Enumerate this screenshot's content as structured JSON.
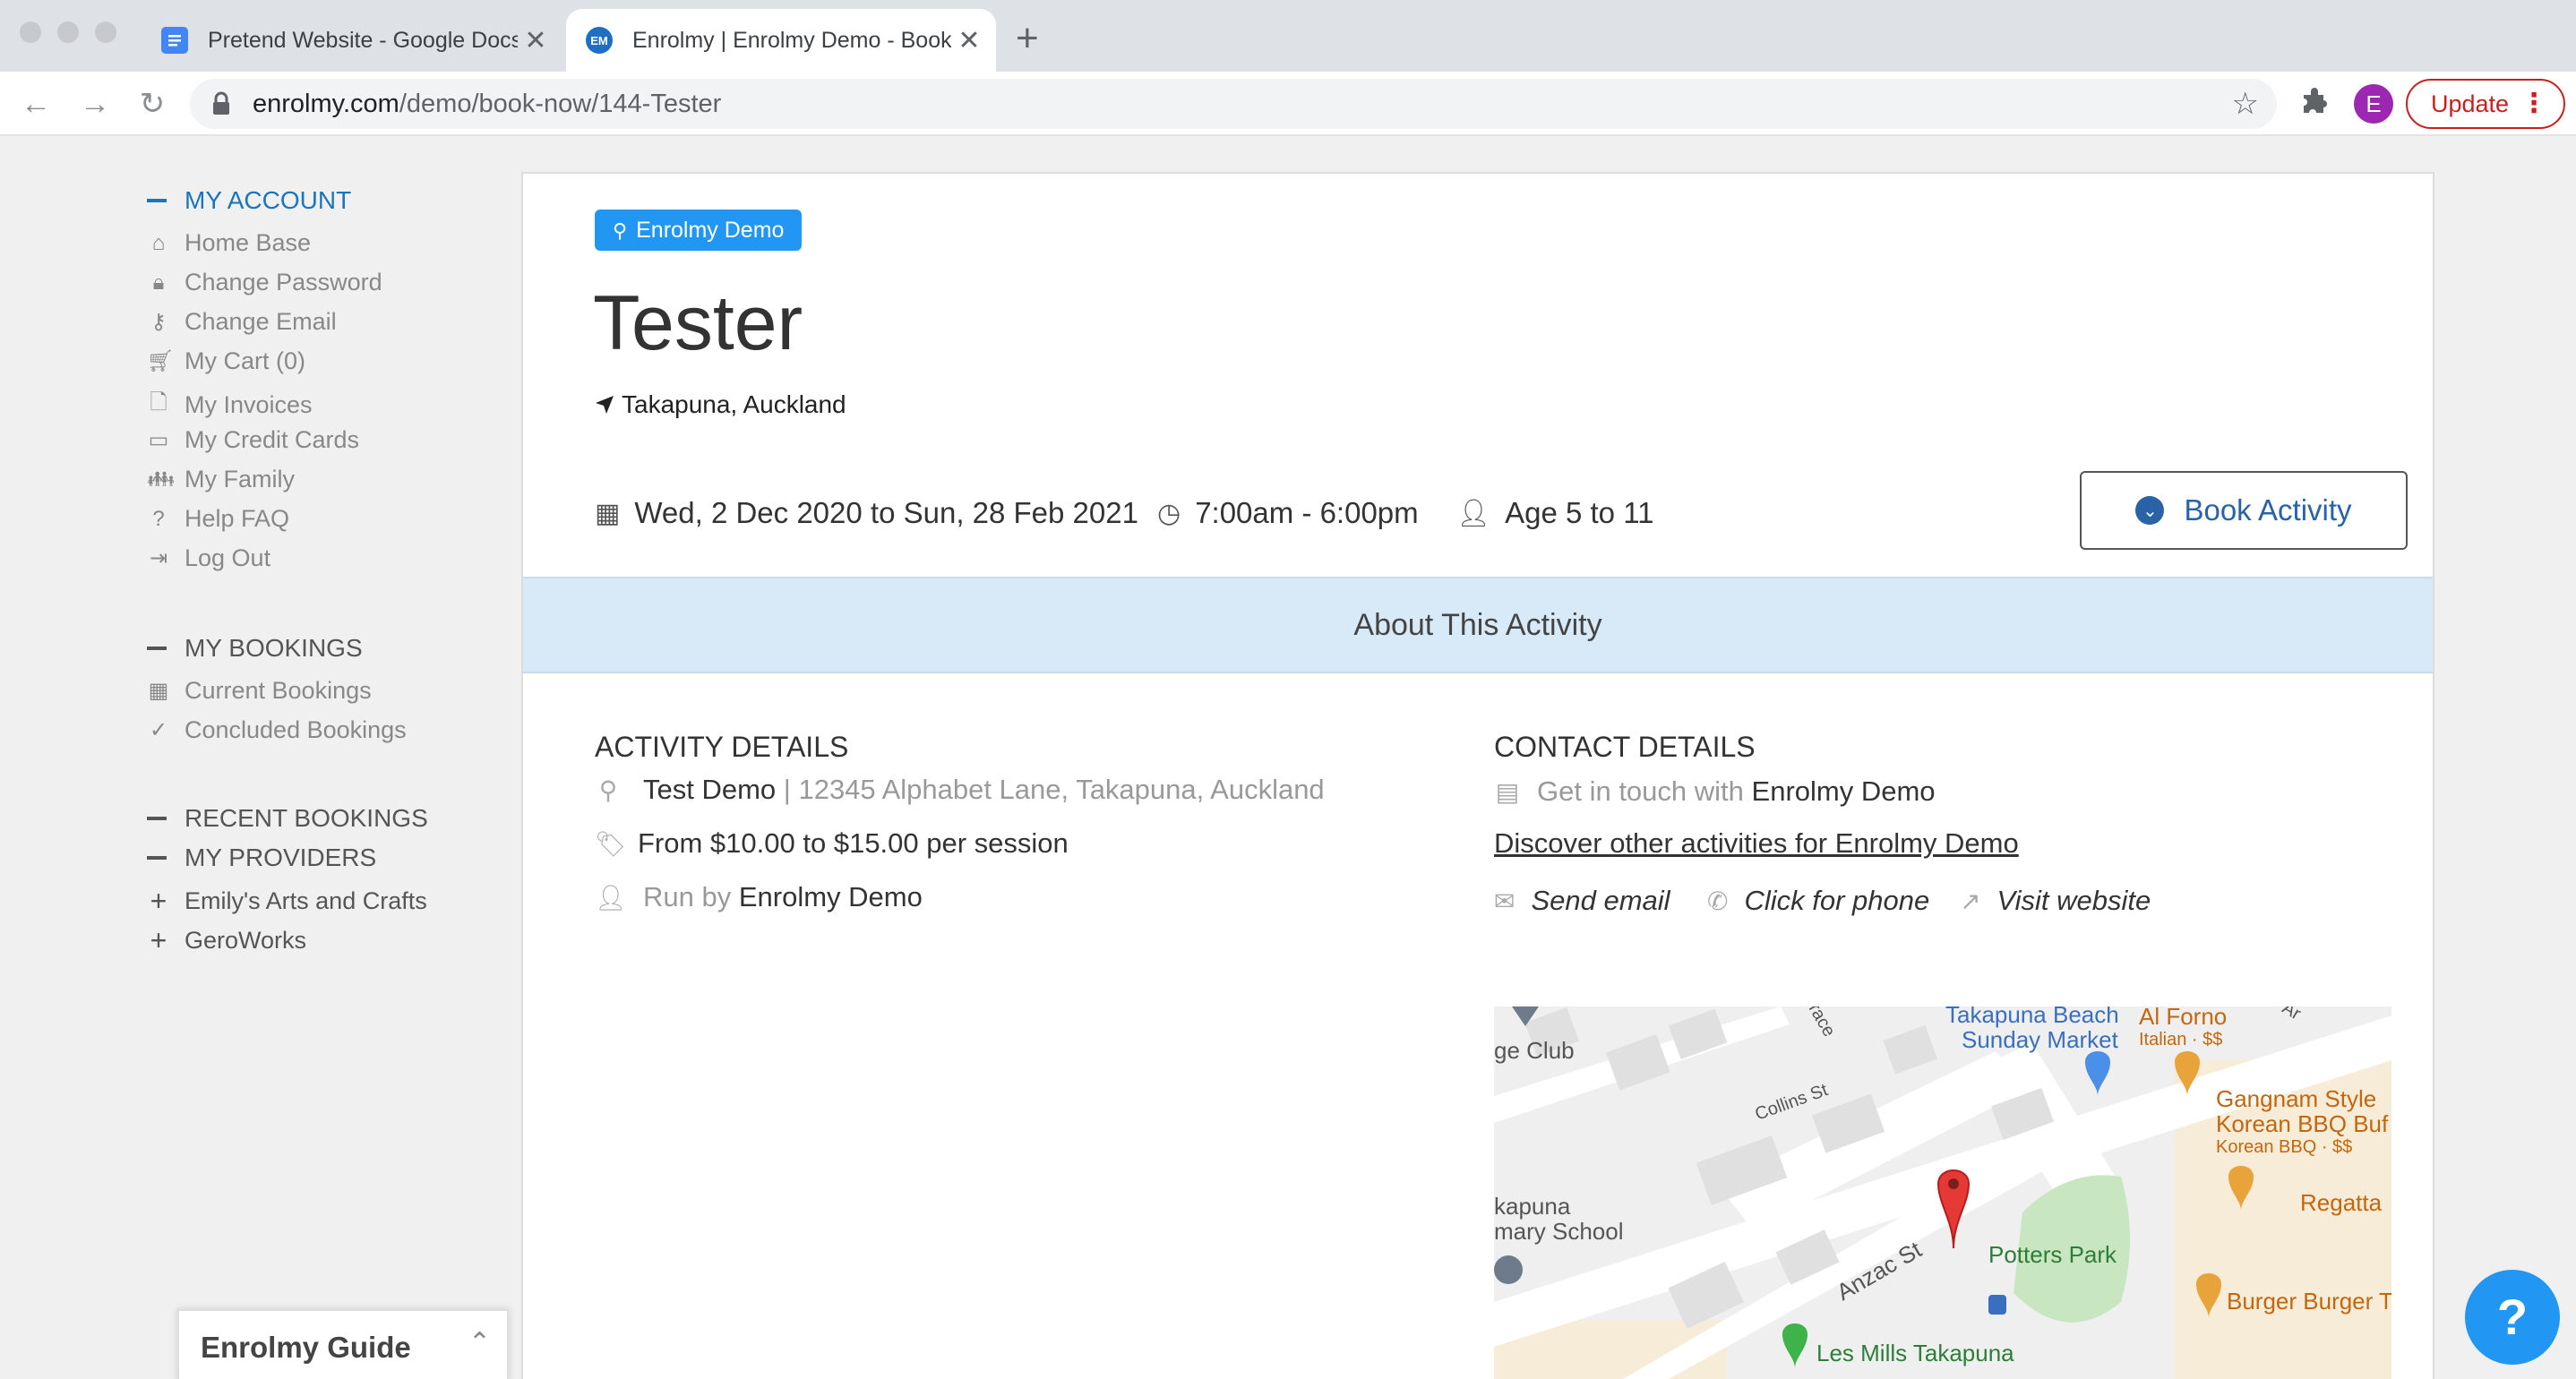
{
  "browser": {
    "tabs": [
      {
        "title": "Pretend Website - Google Docs"
      },
      {
        "title": "Enrolmy | Enrolmy Demo - Book Now"
      }
    ],
    "url_host": "enrolmy.com",
    "url_path": "/demo/book-now/144-Tester",
    "update_label": "Update",
    "avatar_letter": "E"
  },
  "sidebar": {
    "my_account": {
      "heading": "MY ACCOUNT",
      "items": [
        "Home Base",
        "Change Password",
        "Change Email",
        "My Cart (0)",
        "My Invoices",
        "My Credit Cards",
        "My Family",
        "Help FAQ",
        "Log Out"
      ]
    },
    "my_bookings": {
      "heading": "MY BOOKINGS",
      "items": [
        "Current Bookings",
        "Concluded Bookings"
      ]
    },
    "recent_bookings": {
      "heading": "RECENT BOOKINGS"
    },
    "my_providers": {
      "heading": "MY PROVIDERS",
      "items": [
        "Emily's Arts and Crafts",
        "GeroWorks"
      ]
    },
    "guide_title": "Enrolmy Guide"
  },
  "activity": {
    "provider_badge": "Enrolmy Demo",
    "title": "Tester",
    "location": "Takapuna, Auckland",
    "dates": "Wed, 2 Dec 2020 to Sun, 28 Feb 2021",
    "time": "7:00am - 6:00pm",
    "age": "Age 5 to 11",
    "book_label": "Book Activity",
    "about_label": "About This Activity",
    "details": {
      "heading": "ACTIVITY DETAILS",
      "venue": "Test Demo",
      "address": "| 12345 Alphabet Lane, Takapuna, Auckland",
      "price": "From $10.00 to $15.00 per session",
      "run_by_prefix": "Run by",
      "run_by": "Enrolmy Demo"
    },
    "contact": {
      "heading": "CONTACT DETAILS",
      "touch_prefix": "Get in touch with",
      "touch_name": "Enrolmy Demo",
      "discover": "Discover other activities for Enrolmy Demo",
      "send_email": "Send email",
      "phone": "Click for phone",
      "website": "Visit website"
    }
  },
  "map": {
    "labels": {
      "club": "ge Club",
      "collins": "Collins St",
      "terrace": "race",
      "market1": "Takapuna Beach",
      "market2": "Sunday Market",
      "alforno": "Al Forno",
      "alforno_sub": "Italian · $$",
      "gangnam1": "Gangnam Style",
      "gangnam2": "Korean BBQ Buf",
      "gangnam_sub": "Korean BBQ · $$",
      "school1": "kapuna",
      "school2": "mary School",
      "regatta": "Regatta",
      "anzac": "Anzac St",
      "potters": "Potters Park",
      "burger": "Burger Burger T",
      "lesmills": "Les Mills Takapuna",
      "ar": "Ar"
    }
  },
  "help_label": "?",
  "colors": {
    "accent": "#2196f3",
    "link_blue": "#1a75bb",
    "about_bg": "#d8eaf8"
  }
}
